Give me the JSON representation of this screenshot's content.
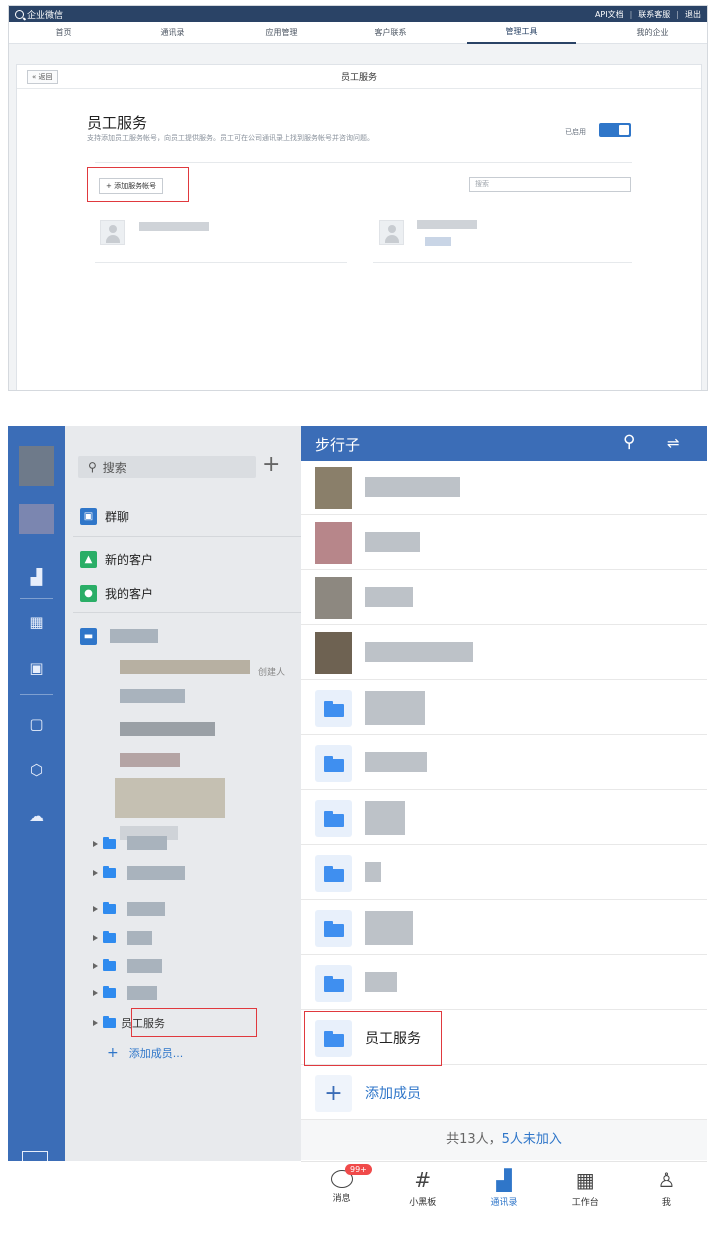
{
  "admin": {
    "brand": "企业微信",
    "top_links": [
      "API文档",
      "联系客服",
      "退出"
    ],
    "nav": [
      {
        "label": "首页",
        "active": false
      },
      {
        "label": "通讯录",
        "active": false
      },
      {
        "label": "应用管理",
        "active": false
      },
      {
        "label": "客户联系",
        "active": false
      },
      {
        "label": "管理工具",
        "active": true
      },
      {
        "label": "我的企业",
        "active": false
      }
    ],
    "back_label": "« 返回",
    "card_title": "员工服务",
    "service_title": "员工服务",
    "service_desc": "支持添加员工服务帐号，向员工提供服务。员工可在公司通讯录上找到服务帐号并咨询问题。",
    "enabled_label": "已启用",
    "add_account_label": "+ 添加服务帐号",
    "search_placeholder": "搜索"
  },
  "client": {
    "left": {
      "search_placeholder": "搜索",
      "plus": "+",
      "items": [
        {
          "label": "群聊",
          "icon": "group-chat-icon",
          "color": "#2f76c9"
        },
        {
          "label": "新的客户",
          "icon": "new-customer-icon",
          "color": "#2aae67"
        },
        {
          "label": "我的客户",
          "icon": "wechat-customer-icon",
          "color": "#2aae67"
        }
      ],
      "creator_label": "创建人",
      "employee_service_node": "员工服务",
      "add_member_label": "添加成员..."
    },
    "right": {
      "header_title": "步行子",
      "employee_service_row": "员工服务",
      "add_member_row": "添加成员",
      "count_prefix": "共13人，",
      "count_link": "5人未加入"
    },
    "tabs": [
      {
        "label": "消息",
        "icon": "message-icon",
        "badge": "99+",
        "active": false
      },
      {
        "label": "小黑板",
        "icon": "blackboard-icon",
        "active": false
      },
      {
        "label": "通讯录",
        "icon": "contacts-icon",
        "active": true
      },
      {
        "label": "工作台",
        "icon": "workbench-icon",
        "active": false
      },
      {
        "label": "我",
        "icon": "me-icon",
        "active": false
      }
    ],
    "highlight_color": "#e0393e",
    "accent_color": "#3b6db7"
  }
}
